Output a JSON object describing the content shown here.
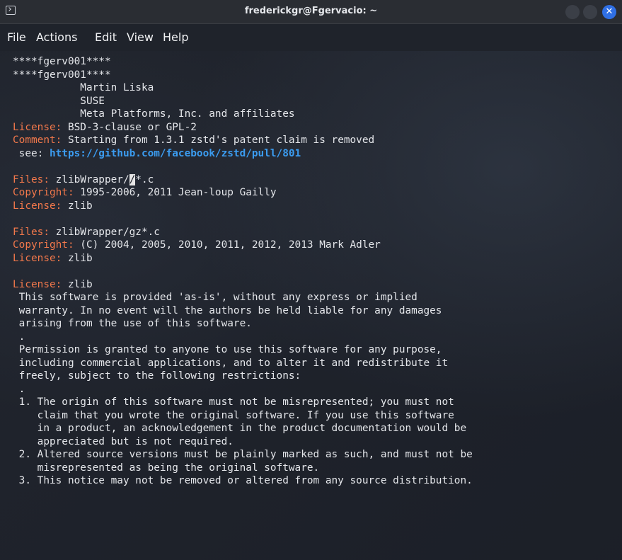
{
  "window": {
    "title": "frederickgr@Fgervacio: ~",
    "close_glyph": "✕"
  },
  "menu": {
    "file": "File",
    "actions": "Actions",
    "edit": "Edit",
    "view": "View",
    "help": "Help"
  },
  "colors": {
    "field_key": "#f2784b",
    "link": "#3b9cf0",
    "text": "#e4e6ea",
    "background": "#1d212a",
    "close_button": "#2f6fe4"
  },
  "terminal": {
    "l01": "****fgerv001****",
    "l02": "****fgerv001****",
    "l03": "           Martin Liska",
    "l04": "           SUSE",
    "l05": "           Meta Platforms, Inc. and affiliates",
    "l06_key": "License:",
    "l06_val": " BSD-3-clause or GPL-2",
    "l07_key": "Comment:",
    "l07_val": " Starting from 1.3.1 zstd's patent claim is removed",
    "l08_pre": " see: ",
    "l08_link": "https://github.com/facebook/zstd/pull/801",
    "l10_key": "Files:",
    "l10_val_a": " zlibWrapper/",
    "l10_cursor": "/",
    "l10_val_b": "*.c",
    "l11_key": "Copyright:",
    "l11_val": " 1995-2006, 2011 Jean-loup Gailly",
    "l12_key": "License:",
    "l12_val": " zlib",
    "l14_key": "Files:",
    "l14_val": " zlibWrapper/gz*.c",
    "l15_key": "Copyright:",
    "l15_val": " (C) 2004, 2005, 2010, 2011, 2012, 2013 Mark Adler",
    "l16_key": "License:",
    "l16_val": " zlib",
    "l18_key": "License:",
    "l18_val": " zlib",
    "l19": " This software is provided 'as-is', without any express or implied",
    "l20": " warranty. In no event will the authors be held liable for any damages",
    "l21": " arising from the use of this software.",
    "l22": " .",
    "l23": " Permission is granted to anyone to use this software for any purpose,",
    "l24": " including commercial applications, and to alter it and redistribute it",
    "l25": " freely, subject to the following restrictions:",
    "l26": " .",
    "l27": " 1. The origin of this software must not be misrepresented; you must not",
    "l28": "    claim that you wrote the original software. If you use this software",
    "l29": "    in a product, an acknowledgement in the product documentation would be",
    "l30": "    appreciated but is not required.",
    "l31": " 2. Altered source versions must be plainly marked as such, and must not be",
    "l32": "    misrepresented as being the original software.",
    "l33": " 3. This notice may not be removed or altered from any source distribution."
  }
}
